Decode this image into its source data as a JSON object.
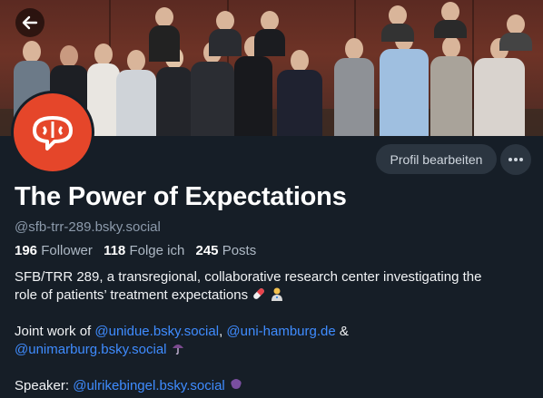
{
  "profile": {
    "display_name": "The Power of Expectations",
    "handle": "@sfb-trr-289.bsky.social",
    "stats": {
      "followers_count": "196",
      "followers_label": "Follower",
      "following_count": "118",
      "following_label": "Folge ich",
      "posts_count": "245",
      "posts_label": "Posts"
    },
    "bio": {
      "line1": "SFB/TRR 289, a transregional, collaborative research center investigating the",
      "line2": "role of patients’ treatment expectations",
      "joint_prefix": "Joint work of ",
      "mention1": "@unidue.bsky.social",
      "sep1": ", ",
      "mention2": "@uni-hamburg.de",
      "sep2": " &",
      "mention3": "@unimarburg.bsky.social",
      "speaker_prefix": "Speaker: ",
      "mention4": "@ulrikebingel.bsky.social"
    }
  },
  "actions": {
    "edit_profile_label": "Profil bearbeiten"
  },
  "icons": {
    "back": "arrow-left-icon",
    "more": "ellipsis-icon",
    "pill": "pill-icon",
    "person": "health-worker-icon",
    "umbrella": "umbrella-icon",
    "brain": "brain-icon"
  },
  "colors": {
    "background": "#161e27",
    "accent_avatar": "#e5462a",
    "mention": "#3f8cff",
    "button_bg": "#2b3540"
  }
}
